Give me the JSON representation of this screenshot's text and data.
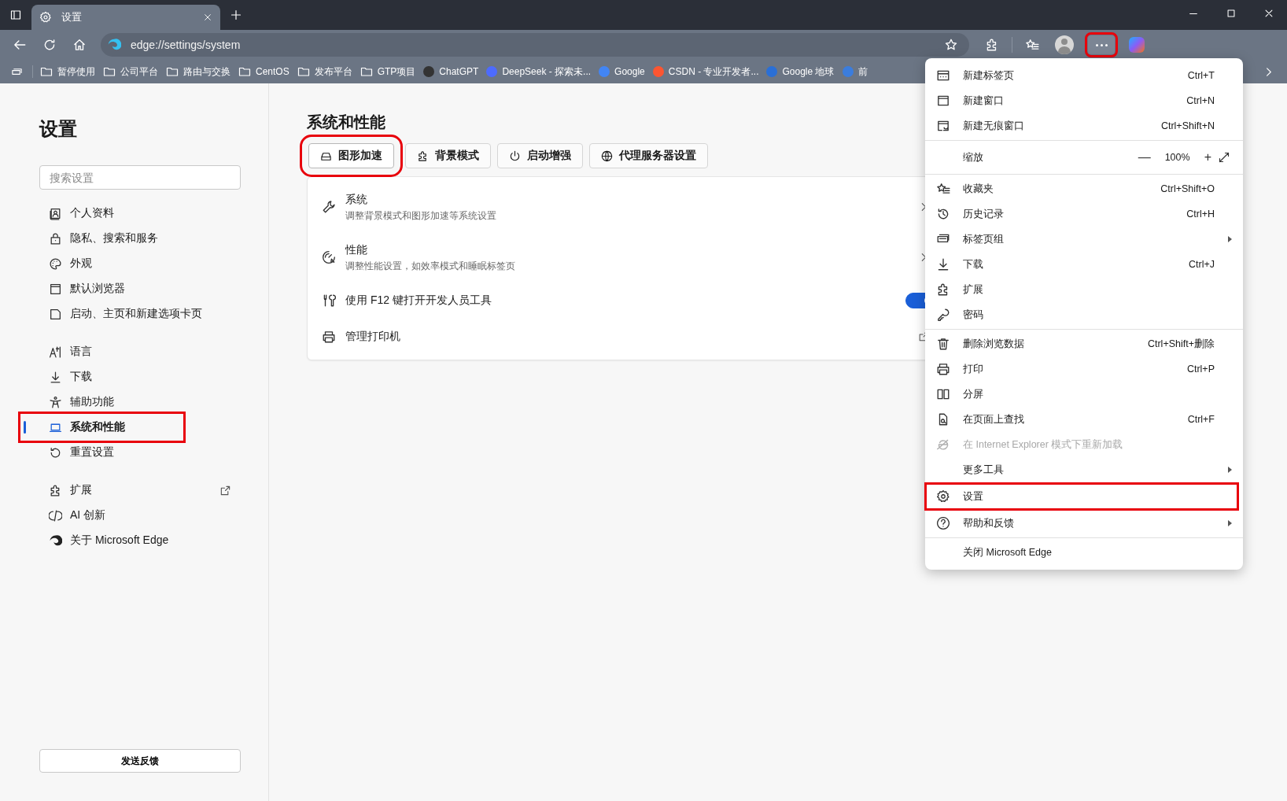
{
  "window": {
    "tab": {
      "title": "设置",
      "selected": true
    }
  },
  "toolbar": {
    "address": "edge://settings/system",
    "more_highlighted": true
  },
  "bookmarks": [
    {
      "kind": "folder",
      "label": "暂停使用"
    },
    {
      "kind": "folder",
      "label": "公司平台"
    },
    {
      "kind": "folder",
      "label": "路由与交换"
    },
    {
      "kind": "folder",
      "label": "CentOS"
    },
    {
      "kind": "folder",
      "label": "发布平台"
    },
    {
      "kind": "folder",
      "label": "GTP项目"
    },
    {
      "kind": "site",
      "label": "ChatGPT",
      "color": "#333333"
    },
    {
      "kind": "site",
      "label": "DeepSeek - 探索未...",
      "color": "#4d6bfe"
    },
    {
      "kind": "site",
      "label": "Google",
      "color": "#4285f4"
    },
    {
      "kind": "site",
      "label": "CSDN - 专业开发者...",
      "color": "#fc5531"
    },
    {
      "kind": "site",
      "label": "Google 地球",
      "color": "#2a6fd6"
    },
    {
      "kind": "site",
      "label": "前",
      "color": "#3b7ddd"
    }
  ],
  "sidebar": {
    "title": "设置",
    "search": {
      "placeholder": "搜索设置"
    },
    "groups": [
      [
        {
          "label": "个人资料",
          "selected": false,
          "highlighted": false,
          "external": false
        },
        {
          "label": "隐私、搜索和服务",
          "selected": false,
          "highlighted": false,
          "external": false
        },
        {
          "label": "外观",
          "selected": false,
          "highlighted": false,
          "external": false
        },
        {
          "label": "默认浏览器",
          "selected": false,
          "highlighted": false,
          "external": false
        },
        {
          "label": "启动、主页和新建选项卡页",
          "selected": false,
          "highlighted": false,
          "external": false
        }
      ],
      [
        {
          "label": "语言",
          "selected": false,
          "highlighted": false,
          "external": false
        },
        {
          "label": "下载",
          "selected": false,
          "highlighted": false,
          "external": false
        },
        {
          "label": "辅助功能",
          "selected": false,
          "highlighted": false,
          "external": false
        },
        {
          "label": "系统和性能",
          "selected": true,
          "highlighted": true,
          "external": false
        },
        {
          "label": "重置设置",
          "selected": false,
          "highlighted": false,
          "external": false
        }
      ],
      [
        {
          "label": "扩展",
          "selected": false,
          "highlighted": false,
          "external": true
        },
        {
          "label": "AI 创新",
          "selected": false,
          "highlighted": false,
          "external": false
        },
        {
          "label": "关于 Microsoft Edge",
          "selected": false,
          "highlighted": false,
          "external": false
        }
      ]
    ],
    "feedback": "发送反馈"
  },
  "main": {
    "title": "系统和性能",
    "chips": [
      {
        "label": "图形加速",
        "highlighted": true
      },
      {
        "label": "背景模式",
        "highlighted": false
      },
      {
        "label": "启动增强",
        "highlighted": false
      },
      {
        "label": "代理服务器设置",
        "highlighted": false
      }
    ],
    "rows": [
      {
        "kind": "link",
        "title": "系统",
        "description": "调整背景模式和图形加速等系统设置"
      },
      {
        "kind": "link",
        "title": "性能",
        "description": "调整性能设置，如效率模式和睡眠标签页"
      },
      {
        "kind": "toggle",
        "title": "使用 F12 键打开开发人员工具",
        "on": true
      },
      {
        "kind": "external",
        "title": "管理打印机"
      }
    ]
  },
  "menu": {
    "groups": [
      [
        {
          "kind": "item",
          "label": "新建标签页",
          "shortcut": "Ctrl+T",
          "submenu": false,
          "disabled": false,
          "highlighted": false
        },
        {
          "kind": "item",
          "label": "新建窗口",
          "shortcut": "Ctrl+N",
          "submenu": false,
          "disabled": false,
          "highlighted": false
        },
        {
          "kind": "item",
          "label": "新建无痕窗口",
          "shortcut": "Ctrl+Shift+N",
          "submenu": false,
          "disabled": false,
          "highlighted": false
        }
      ],
      [
        {
          "kind": "zoom",
          "label": "缩放",
          "value": "100%",
          "minus": "—",
          "plus": "+"
        }
      ],
      [
        {
          "kind": "item",
          "label": "收藏夹",
          "shortcut": "Ctrl+Shift+O",
          "submenu": false,
          "disabled": false,
          "highlighted": false
        },
        {
          "kind": "item",
          "label": "历史记录",
          "shortcut": "Ctrl+H",
          "submenu": false,
          "disabled": false,
          "highlighted": false
        },
        {
          "kind": "item",
          "label": "标签页组",
          "submenu": true,
          "disabled": false,
          "highlighted": false
        },
        {
          "kind": "item",
          "label": "下载",
          "shortcut": "Ctrl+J",
          "submenu": false,
          "disabled": false,
          "highlighted": false
        },
        {
          "kind": "item",
          "label": "扩展",
          "submenu": false,
          "disabled": false,
          "highlighted": false
        },
        {
          "kind": "item",
          "label": "密码",
          "submenu": false,
          "disabled": false,
          "highlighted": false
        }
      ],
      [
        {
          "kind": "item",
          "label": "删除浏览数据",
          "shortcut": "Ctrl+Shift+删除",
          "submenu": false,
          "disabled": false,
          "highlighted": false
        },
        {
          "kind": "item",
          "label": "打印",
          "shortcut": "Ctrl+P",
          "submenu": false,
          "disabled": false,
          "highlighted": false
        },
        {
          "kind": "item",
          "label": "分屏",
          "submenu": false,
          "disabled": false,
          "highlighted": false
        },
        {
          "kind": "item",
          "label": "在页面上查找",
          "shortcut": "Ctrl+F",
          "submenu": false,
          "disabled": false,
          "highlighted": false
        },
        {
          "kind": "item",
          "label": "在 Internet Explorer 模式下重新加载",
          "submenu": false,
          "disabled": true,
          "highlighted": false
        },
        {
          "kind": "item",
          "label": "更多工具",
          "submenu": true,
          "disabled": false,
          "highlighted": false
        },
        {
          "kind": "item",
          "label": "设置",
          "submenu": false,
          "disabled": false,
          "highlighted": true
        },
        {
          "kind": "item",
          "label": "帮助和反馈",
          "submenu": true,
          "disabled": false,
          "highlighted": false
        }
      ],
      [
        {
          "kind": "item",
          "label": "关闭 Microsoft Edge",
          "submenu": false,
          "disabled": false,
          "highlighted": false
        }
      ]
    ]
  }
}
